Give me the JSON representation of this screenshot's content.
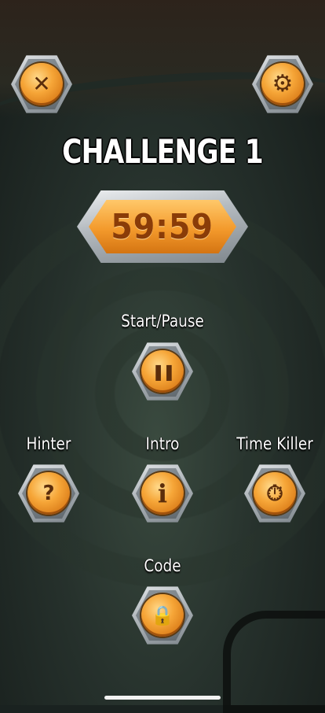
{
  "title": "CHALLENGE 1",
  "timer": "59:59",
  "buttons": {
    "close": {
      "icon": "close-icon",
      "glyph": "✕"
    },
    "settings": {
      "icon": "gear-icon",
      "glyph": "⚙"
    },
    "start_pause": {
      "label": "Start/Pause",
      "icon": "pause-icon",
      "glyph": "❚❚"
    },
    "hinter": {
      "label": "Hinter",
      "icon": "lightbulb-icon",
      "glyph": "?"
    },
    "intro": {
      "label": "Intro",
      "icon": "info-icon",
      "glyph": "i"
    },
    "time_killer": {
      "label": "Time Killer",
      "icon": "stopwatch-icon",
      "glyph": "⏱"
    },
    "code": {
      "label": "Code",
      "icon": "lock-icon",
      "glyph": "🔒"
    }
  },
  "colors": {
    "accent_orange": "#f39a2c",
    "timer_text": "#8a3c08",
    "stone": "#aeb4b9"
  }
}
